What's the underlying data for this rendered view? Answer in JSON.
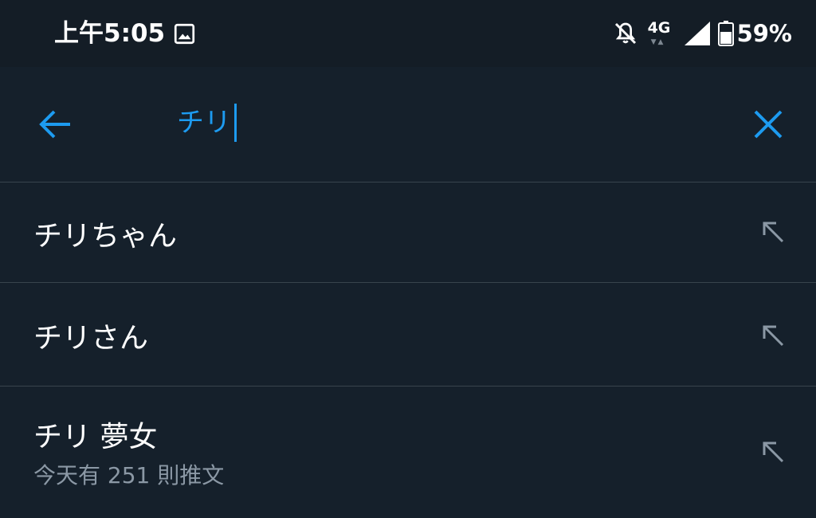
{
  "status_bar": {
    "time": "上午5:05",
    "network": "4G",
    "battery_percent": "59%",
    "icons": [
      "image-icon",
      "bell-off-icon",
      "signal-icon",
      "battery-icon"
    ]
  },
  "search": {
    "query": "チリ",
    "back_icon": "arrow-left-icon",
    "clear_icon": "close-icon",
    "accent_color": "#1d9bf0"
  },
  "suggestions": [
    {
      "label": "チリちゃん",
      "sub": ""
    },
    {
      "label": "チリさん",
      "sub": ""
    },
    {
      "label": "チリ 夢女",
      "sub": "今天有 251 則推文"
    }
  ],
  "colors": {
    "background": "#15202b",
    "status_bar": "#141d26",
    "divider": "#38444d",
    "secondary_text": "#8b98a5",
    "arrow": "#8b98a5"
  }
}
